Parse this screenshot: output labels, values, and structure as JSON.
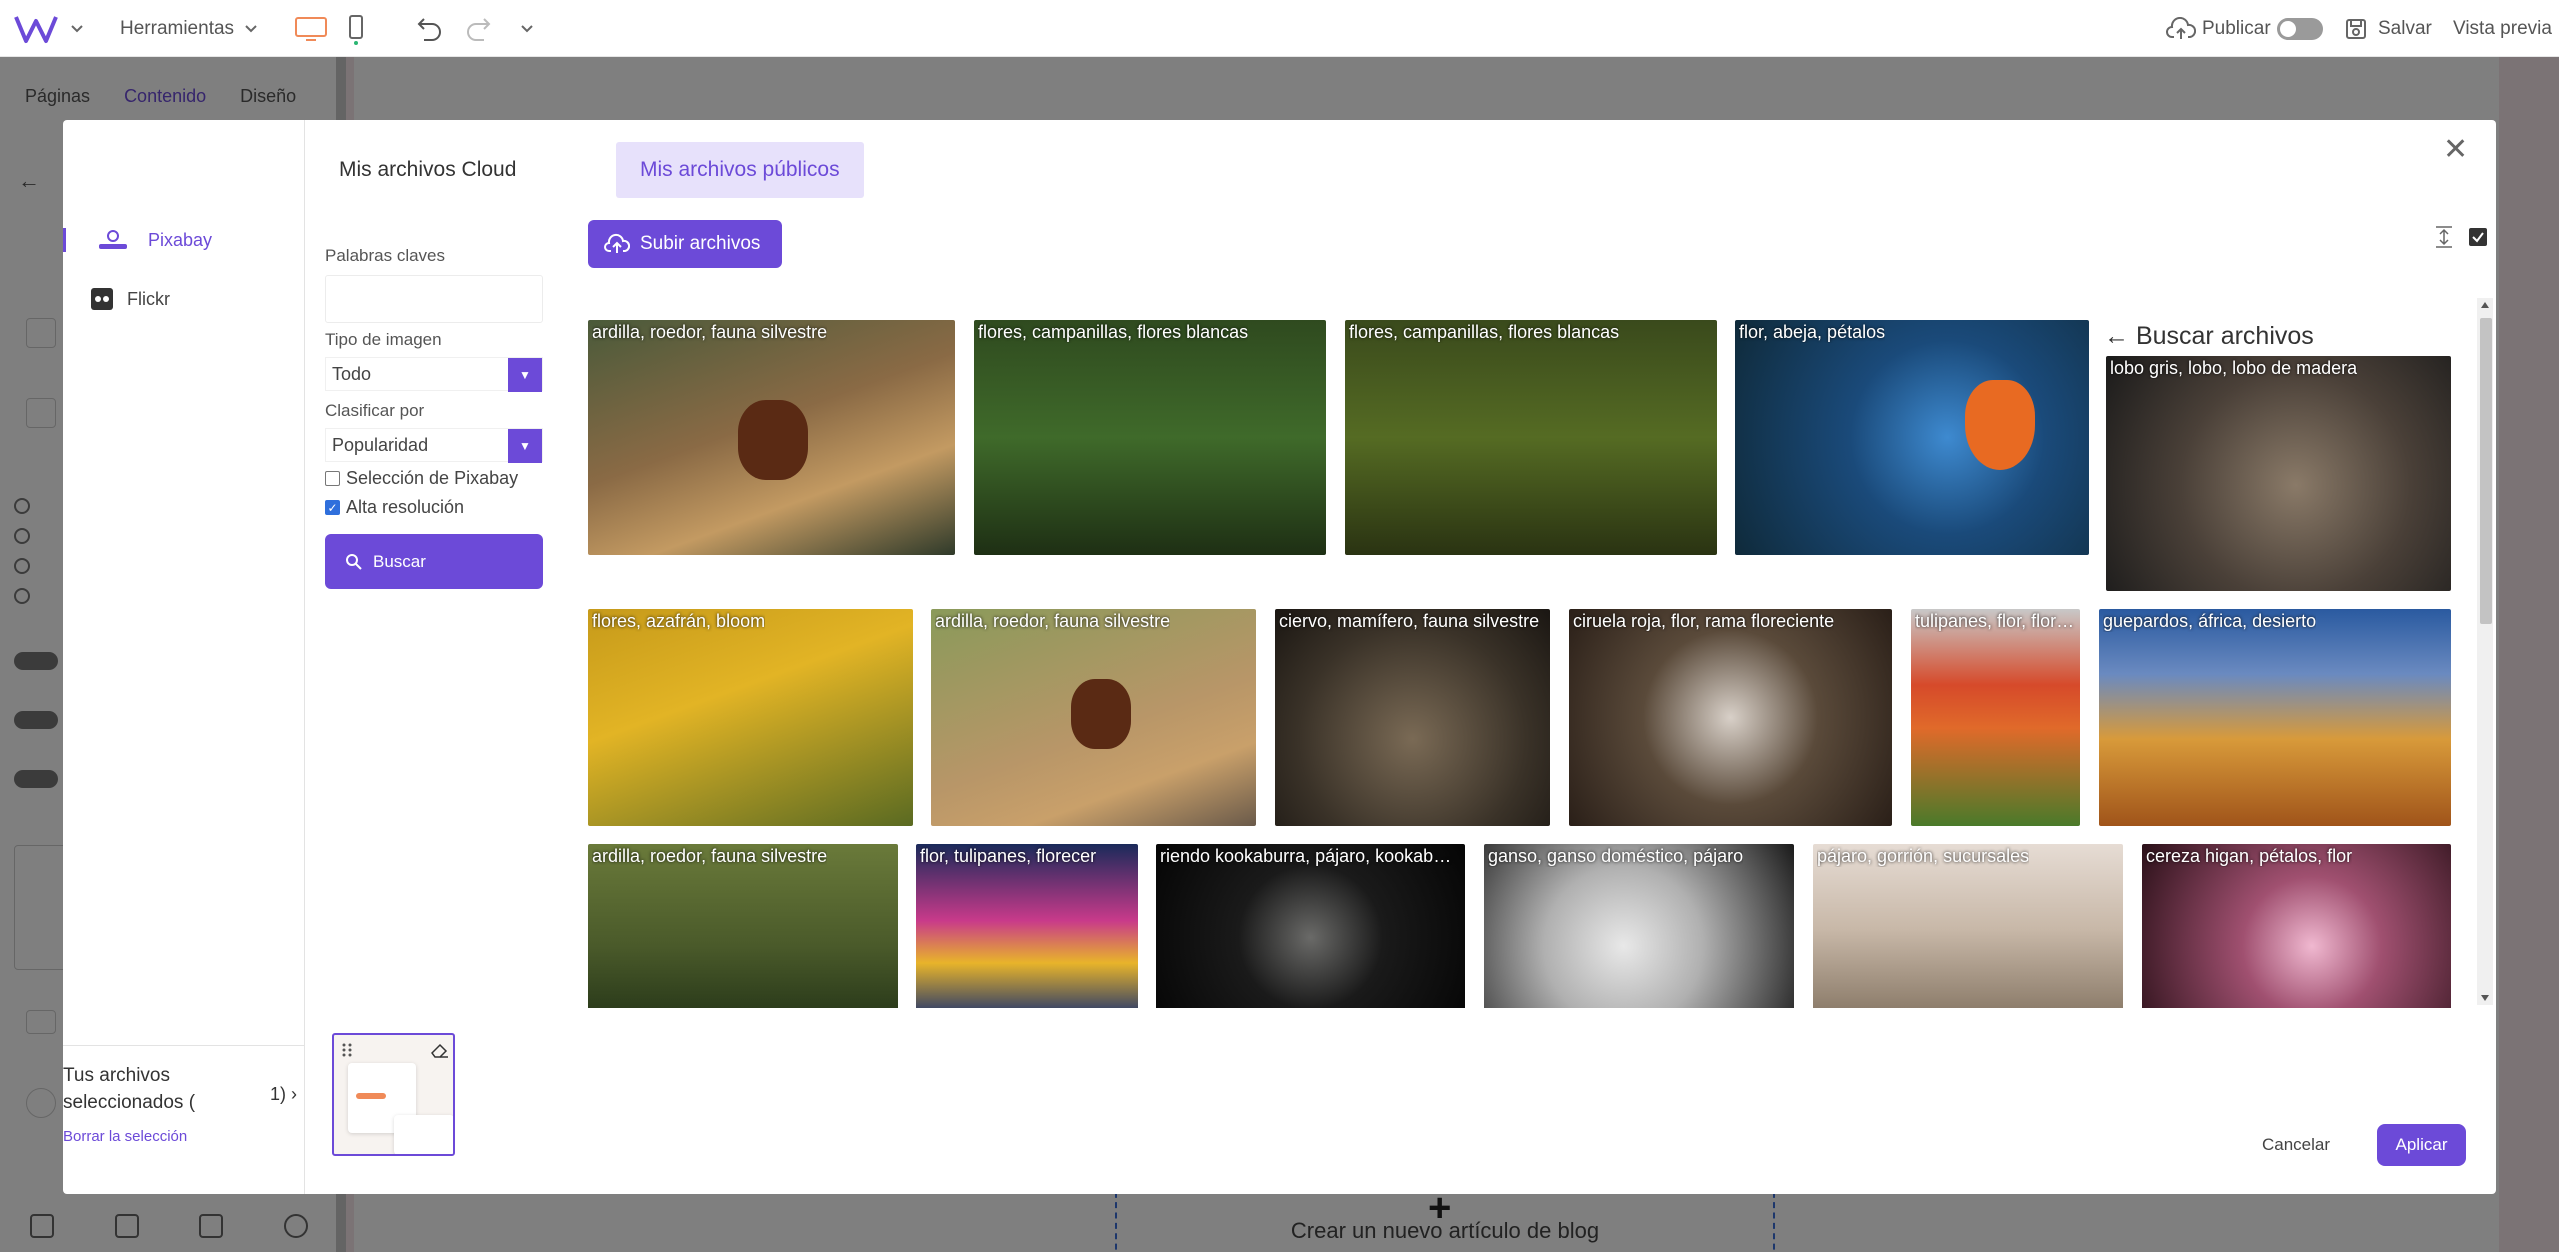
{
  "toolbar": {
    "tools_label": "Herramientas",
    "publish_label": "Publicar",
    "save_label": "Salvar",
    "preview_label": "Vista previa"
  },
  "editor": {
    "tabs": [
      "Páginas",
      "Contenido",
      "Diseño"
    ],
    "new_post_label": "Crear un nuevo artículo de blog"
  },
  "modal": {
    "tabs": [
      "Mis archivos Cloud",
      "Mis archivos públicos"
    ],
    "sources": [
      "Pixabay",
      "Flickr"
    ],
    "keywords_label": "Palabras claves",
    "keywords_value": "",
    "image_type_label": "Tipo de imagen",
    "image_type_value": "Todo",
    "sort_label": "Clasificar por",
    "sort_value": "Popularidad",
    "pixabay_selection_label": "Selección de Pixabay",
    "high_res_label": "Alta resolución",
    "search_button": "Buscar",
    "upload_button": "Subir archivos",
    "find_files_link": "← Buscar archivos",
    "selected_label": "Tus archivos seleccionados (",
    "selected_count": "1)",
    "clear_selection": "Borrar la selección",
    "cancel_button": "Cancelar",
    "apply_button": "Aplicar",
    "images": [
      "ardilla, roedor, fauna silvestre",
      "flores, campanillas, flores blancas",
      "flores, campanillas, flores blancas",
      "flor, abeja, pétalos",
      "lobo gris, lobo, lobo de madera",
      "flores, azafrán, bloom",
      "ardilla, roedor, fauna silvestre",
      "ciervo, mamífero, fauna silvestre",
      "ciruela roja, flor, rama floreciente",
      "tulipanes, flor, flore...",
      "guepardos, áfrica, desierto",
      "ardilla, roedor, fauna silvestre",
      "flor, tulipanes, florecer",
      "riendo kookaburra, pájaro, kookabur...",
      "ganso, ganso doméstico, pájaro",
      "pájaro, gorrión, sucursales",
      "cereza higan, pétalos, flor"
    ]
  },
  "colors": {
    "accent": "#6c4ad8",
    "accent_light": "#e7e1fb",
    "device_orange": "#f08a58"
  }
}
